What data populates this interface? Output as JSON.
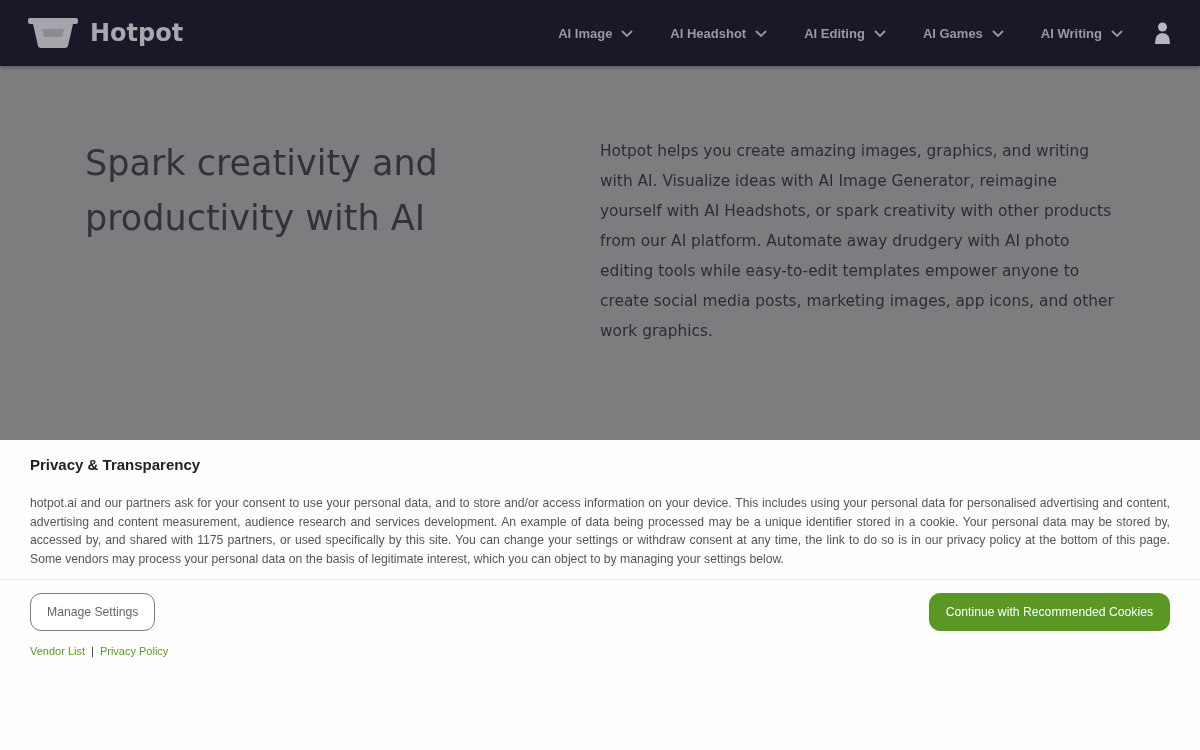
{
  "header": {
    "brand": "Hotpot",
    "nav": [
      {
        "label": "AI Image"
      },
      {
        "label": "AI Headshot"
      },
      {
        "label": "AI Editing"
      },
      {
        "label": "AI Games"
      },
      {
        "label": "AI Writing"
      }
    ]
  },
  "hero": {
    "headline": "Spark creativity and productivity with AI",
    "description": "Hotpot helps you create amazing images, graphics, and writing with AI. Visualize ideas with AI Image Generator, reimagine yourself with AI Headshots, or spark creativity with other products from our AI platform. Automate away drudgery with AI photo editing tools while easy-to-edit templates empower anyone to create social media posts, marketing images, app icons, and other work graphics."
  },
  "consent": {
    "title": "Privacy & Transparency",
    "body": "hotpot.ai and our partners ask for your consent to use your personal data, and to store and/or access information on your device. This includes using your personal data for personalised advertising and content, advertising and content measurement, audience research and services development. An example of data being processed may be a unique identifier stored in a cookie. Your personal data may be stored by, accessed by, and shared with 1175 partners, or used specifically by this site. You can change your settings or withdraw consent at any time, the link to do so is in our privacy policy at the bottom of this page. Some vendors may process your personal data on the basis of legitimate interest, which you can object to by managing your settings below.",
    "buttons": [
      {
        "label": "Manage Settings",
        "kind": "secondary"
      },
      {
        "label": "Continue with Recommended Cookies",
        "kind": "primary"
      }
    ],
    "links": [
      "Vendor List",
      "Privacy Policy"
    ],
    "link_separator": "|"
  }
}
